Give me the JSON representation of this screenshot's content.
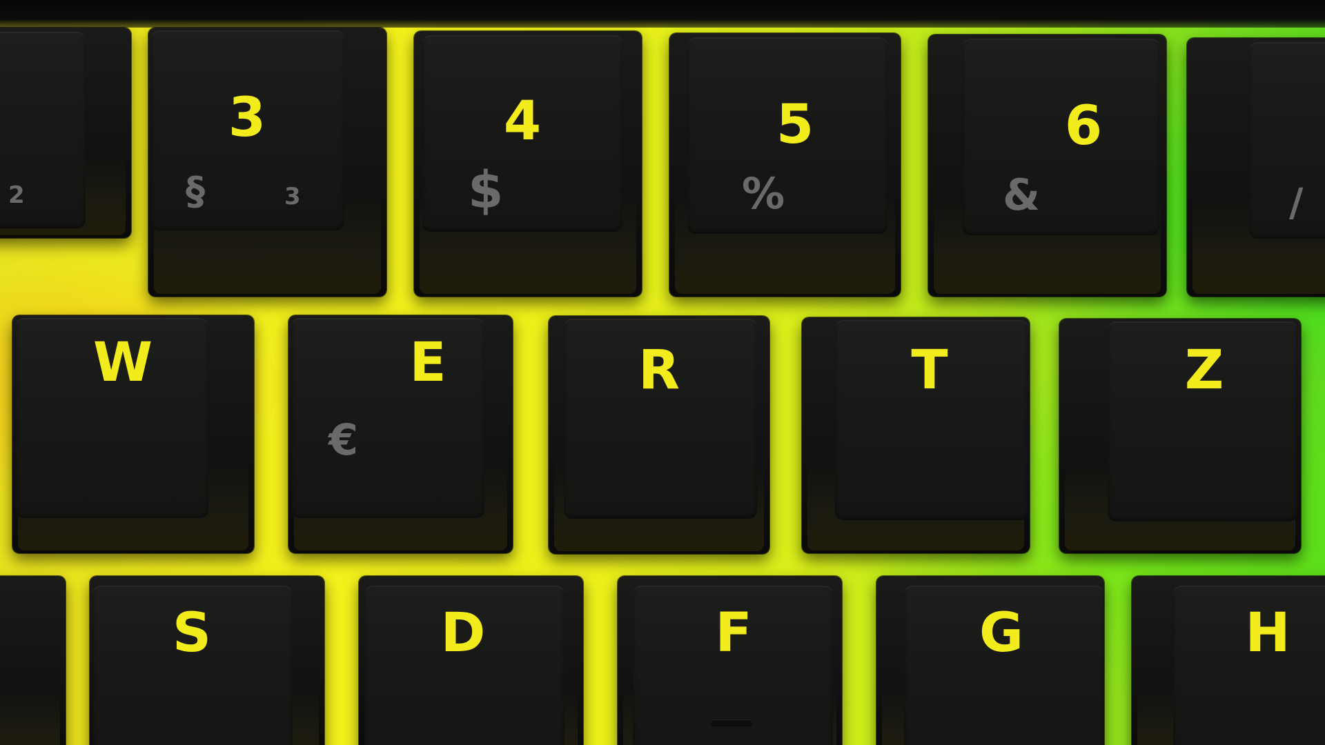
{
  "image_description_colors": {
    "legend": "#f2ec1c",
    "secondary_legend": "#6a6a68",
    "keycap": "#161615",
    "backlight_left": "#f4f11c",
    "backlight_right": "#5ed81e"
  },
  "number_row": [
    {
      "main": "",
      "sub_left": "2",
      "sub_right": ""
    },
    {
      "main": "3",
      "sub_left": "§",
      "sub_right": "3"
    },
    {
      "main": "4",
      "sub_left": "$",
      "sub_right": ""
    },
    {
      "main": "5",
      "sub_left": "%",
      "sub_right": ""
    },
    {
      "main": "6",
      "sub_left": "&",
      "sub_right": ""
    },
    {
      "main": "",
      "sub_left": "/",
      "sub_right": ""
    }
  ],
  "letter_row_1": [
    {
      "main": "W",
      "sub": ""
    },
    {
      "main": "E",
      "sub": "€"
    },
    {
      "main": "R",
      "sub": ""
    },
    {
      "main": "T",
      "sub": ""
    },
    {
      "main": "Z",
      "sub": ""
    }
  ],
  "letter_row_2": [
    {
      "main": "",
      "sub": ""
    },
    {
      "main": "S",
      "sub": ""
    },
    {
      "main": "D",
      "sub": ""
    },
    {
      "main": "F",
      "sub": ""
    },
    {
      "main": "G",
      "sub": ""
    },
    {
      "main": "H",
      "sub": ""
    }
  ]
}
